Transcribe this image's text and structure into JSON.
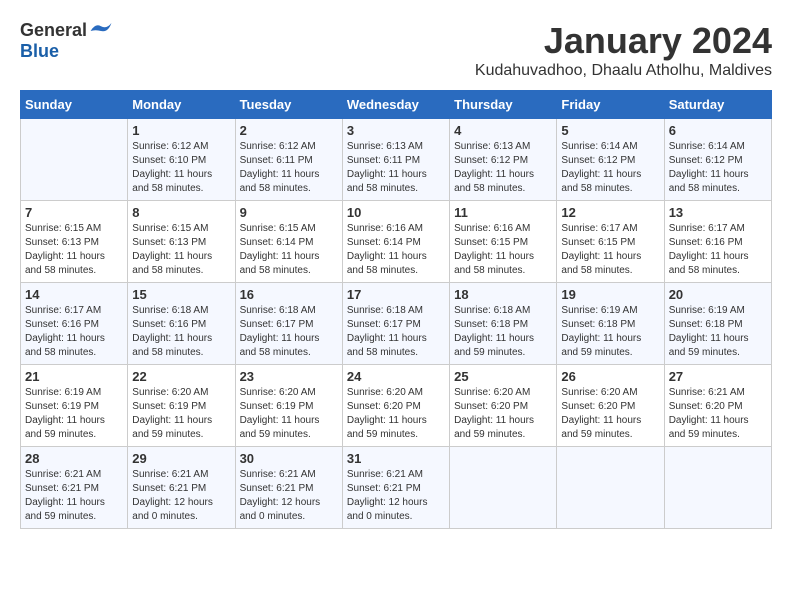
{
  "logo": {
    "general": "General",
    "blue": "Blue"
  },
  "title": "January 2024",
  "location": "Kudahuvadhoo, Dhaalu Atholhu, Maldives",
  "weekdays": [
    "Sunday",
    "Monday",
    "Tuesday",
    "Wednesday",
    "Thursday",
    "Friday",
    "Saturday"
  ],
  "weeks": [
    [
      {
        "day": "",
        "info": ""
      },
      {
        "day": "1",
        "info": "Sunrise: 6:12 AM\nSunset: 6:10 PM\nDaylight: 11 hours\nand 58 minutes."
      },
      {
        "day": "2",
        "info": "Sunrise: 6:12 AM\nSunset: 6:11 PM\nDaylight: 11 hours\nand 58 minutes."
      },
      {
        "day": "3",
        "info": "Sunrise: 6:13 AM\nSunset: 6:11 PM\nDaylight: 11 hours\nand 58 minutes."
      },
      {
        "day": "4",
        "info": "Sunrise: 6:13 AM\nSunset: 6:12 PM\nDaylight: 11 hours\nand 58 minutes."
      },
      {
        "day": "5",
        "info": "Sunrise: 6:14 AM\nSunset: 6:12 PM\nDaylight: 11 hours\nand 58 minutes."
      },
      {
        "day": "6",
        "info": "Sunrise: 6:14 AM\nSunset: 6:12 PM\nDaylight: 11 hours\nand 58 minutes."
      }
    ],
    [
      {
        "day": "7",
        "info": "Sunrise: 6:15 AM\nSunset: 6:13 PM\nDaylight: 11 hours\nand 58 minutes."
      },
      {
        "day": "8",
        "info": "Sunrise: 6:15 AM\nSunset: 6:13 PM\nDaylight: 11 hours\nand 58 minutes."
      },
      {
        "day": "9",
        "info": "Sunrise: 6:15 AM\nSunset: 6:14 PM\nDaylight: 11 hours\nand 58 minutes."
      },
      {
        "day": "10",
        "info": "Sunrise: 6:16 AM\nSunset: 6:14 PM\nDaylight: 11 hours\nand 58 minutes."
      },
      {
        "day": "11",
        "info": "Sunrise: 6:16 AM\nSunset: 6:15 PM\nDaylight: 11 hours\nand 58 minutes."
      },
      {
        "day": "12",
        "info": "Sunrise: 6:17 AM\nSunset: 6:15 PM\nDaylight: 11 hours\nand 58 minutes."
      },
      {
        "day": "13",
        "info": "Sunrise: 6:17 AM\nSunset: 6:16 PM\nDaylight: 11 hours\nand 58 minutes."
      }
    ],
    [
      {
        "day": "14",
        "info": "Sunrise: 6:17 AM\nSunset: 6:16 PM\nDaylight: 11 hours\nand 58 minutes."
      },
      {
        "day": "15",
        "info": "Sunrise: 6:18 AM\nSunset: 6:16 PM\nDaylight: 11 hours\nand 58 minutes."
      },
      {
        "day": "16",
        "info": "Sunrise: 6:18 AM\nSunset: 6:17 PM\nDaylight: 11 hours\nand 58 minutes."
      },
      {
        "day": "17",
        "info": "Sunrise: 6:18 AM\nSunset: 6:17 PM\nDaylight: 11 hours\nand 58 minutes."
      },
      {
        "day": "18",
        "info": "Sunrise: 6:18 AM\nSunset: 6:18 PM\nDaylight: 11 hours\nand 59 minutes."
      },
      {
        "day": "19",
        "info": "Sunrise: 6:19 AM\nSunset: 6:18 PM\nDaylight: 11 hours\nand 59 minutes."
      },
      {
        "day": "20",
        "info": "Sunrise: 6:19 AM\nSunset: 6:18 PM\nDaylight: 11 hours\nand 59 minutes."
      }
    ],
    [
      {
        "day": "21",
        "info": "Sunrise: 6:19 AM\nSunset: 6:19 PM\nDaylight: 11 hours\nand 59 minutes."
      },
      {
        "day": "22",
        "info": "Sunrise: 6:20 AM\nSunset: 6:19 PM\nDaylight: 11 hours\nand 59 minutes."
      },
      {
        "day": "23",
        "info": "Sunrise: 6:20 AM\nSunset: 6:19 PM\nDaylight: 11 hours\nand 59 minutes."
      },
      {
        "day": "24",
        "info": "Sunrise: 6:20 AM\nSunset: 6:20 PM\nDaylight: 11 hours\nand 59 minutes."
      },
      {
        "day": "25",
        "info": "Sunrise: 6:20 AM\nSunset: 6:20 PM\nDaylight: 11 hours\nand 59 minutes."
      },
      {
        "day": "26",
        "info": "Sunrise: 6:20 AM\nSunset: 6:20 PM\nDaylight: 11 hours\nand 59 minutes."
      },
      {
        "day": "27",
        "info": "Sunrise: 6:21 AM\nSunset: 6:20 PM\nDaylight: 11 hours\nand 59 minutes."
      }
    ],
    [
      {
        "day": "28",
        "info": "Sunrise: 6:21 AM\nSunset: 6:21 PM\nDaylight: 11 hours\nand 59 minutes."
      },
      {
        "day": "29",
        "info": "Sunrise: 6:21 AM\nSunset: 6:21 PM\nDaylight: 12 hours\nand 0 minutes."
      },
      {
        "day": "30",
        "info": "Sunrise: 6:21 AM\nSunset: 6:21 PM\nDaylight: 12 hours\nand 0 minutes."
      },
      {
        "day": "31",
        "info": "Sunrise: 6:21 AM\nSunset: 6:21 PM\nDaylight: 12 hours\nand 0 minutes."
      },
      {
        "day": "",
        "info": ""
      },
      {
        "day": "",
        "info": ""
      },
      {
        "day": "",
        "info": ""
      }
    ]
  ]
}
